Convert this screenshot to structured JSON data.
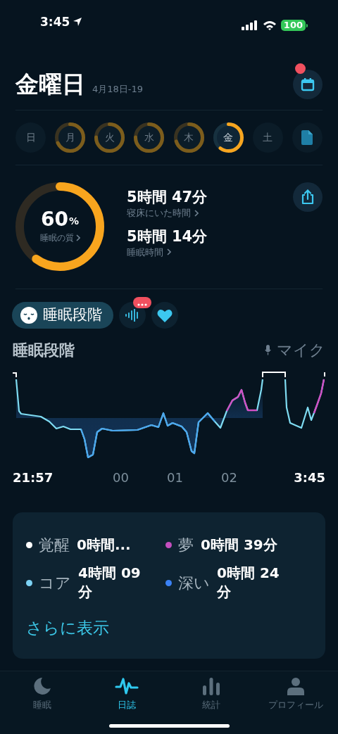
{
  "status_bar": {
    "time": "3:45",
    "battery": "100"
  },
  "header": {
    "title": "金曜日",
    "date": "4月18日-19",
    "notification": true
  },
  "week": [
    {
      "label": "日",
      "selected": false
    },
    {
      "label": "月",
      "selected": false
    },
    {
      "label": "火",
      "selected": false
    },
    {
      "label": "水",
      "selected": false
    },
    {
      "label": "木",
      "selected": false
    },
    {
      "label": "金",
      "selected": true
    },
    {
      "label": "土",
      "selected": false
    }
  ],
  "quality": {
    "value": "60",
    "unit": "%",
    "label": "睡眠の質"
  },
  "stats": [
    {
      "value": "5時間 47分",
      "label": "寝床にいた時間"
    },
    {
      "value": "5時間 14分",
      "label": "睡眠時間"
    }
  ],
  "stage_tabs": [
    {
      "kind": "stages",
      "text": "睡眠段階",
      "selected": true
    },
    {
      "kind": "sound",
      "selected": false,
      "badge": true
    },
    {
      "kind": "heart",
      "selected": false
    }
  ],
  "chart": {
    "title": "睡眠段階",
    "source": "マイク",
    "x_labels": [
      {
        "text": "21:57",
        "kind": "end"
      },
      {
        "text": "00",
        "kind": "hour"
      },
      {
        "text": "01",
        "kind": "hour"
      },
      {
        "text": "02",
        "kind": "hour"
      },
      {
        "text": "3:45",
        "kind": "end"
      }
    ]
  },
  "legend": [
    {
      "label": "覚醒",
      "value": "0時間...",
      "color": "#ffffff"
    },
    {
      "label": "夢",
      "value": "0時間 39分",
      "color": "#c44fbf"
    },
    {
      "label": "コア",
      "value": "4時間 09分",
      "color": "#7dd3f5"
    },
    {
      "label": "深い",
      "value": "0時間 24分",
      "color": "#3b82f6"
    }
  ],
  "more_link": "さらに表示",
  "tab_bar": [
    {
      "kind": "moon",
      "label": "睡眠",
      "selected": false
    },
    {
      "kind": "wave",
      "label": "日誌",
      "selected": true
    },
    {
      "kind": "bars",
      "label": "統計",
      "selected": false
    },
    {
      "kind": "person",
      "label": "プロフィール",
      "selected": false
    }
  ]
}
